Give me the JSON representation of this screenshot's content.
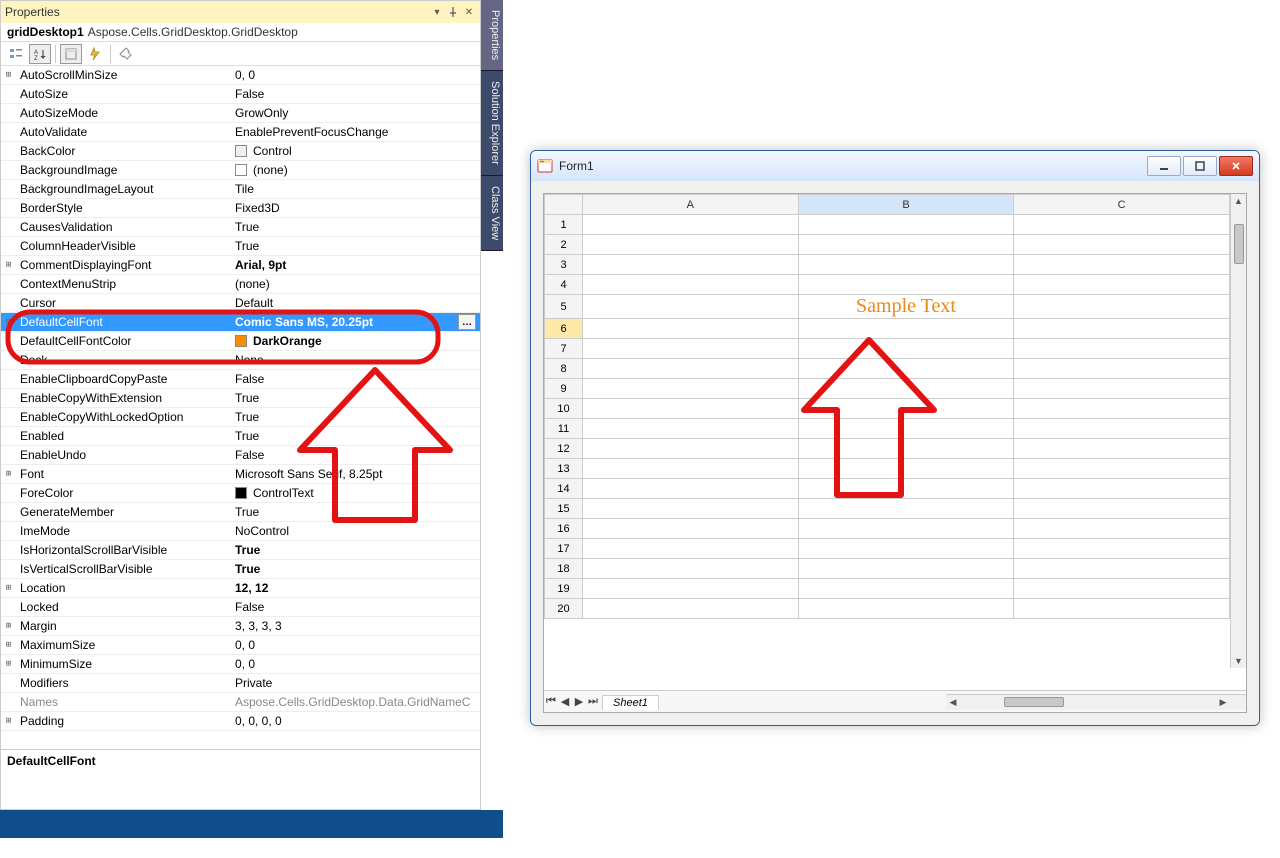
{
  "properties_panel": {
    "title": "Properties",
    "object_name": "gridDesktop1",
    "object_type": "Aspose.Cells.GridDesktop.GridDesktop",
    "help_property": "DefaultCellFont",
    "toolbar_icons": {
      "categorized": "categorized-icon",
      "alphabetical": "alphabetical-icon",
      "properties": "properties-icon",
      "events": "events-icon",
      "propertypages": "property-pages-icon"
    },
    "rows": [
      {
        "exp": "+",
        "name": "AutoScrollMinSize",
        "value": "0, 0"
      },
      {
        "name": "AutoSize",
        "value": "False"
      },
      {
        "name": "AutoSizeMode",
        "value": "GrowOnly"
      },
      {
        "name": "AutoValidate",
        "value": "EnablePreventFocusChange"
      },
      {
        "name": "BackColor",
        "value": "Control",
        "swatch": "#f0f0f0"
      },
      {
        "name": "BackgroundImage",
        "value": "(none)",
        "swatch": "#ffffff"
      },
      {
        "name": "BackgroundImageLayout",
        "value": "Tile"
      },
      {
        "name": "BorderStyle",
        "value": "Fixed3D"
      },
      {
        "name": "CausesValidation",
        "value": "True"
      },
      {
        "name": "ColumnHeaderVisible",
        "value": "True"
      },
      {
        "exp": "+",
        "name": "CommentDisplayingFont",
        "value": "Arial, 9pt",
        "bold": true
      },
      {
        "name": "ContextMenuStrip",
        "value": "(none)"
      },
      {
        "name": "Cursor",
        "value": "Default"
      },
      {
        "exp": "+",
        "name": "DefaultCellFont",
        "value": "Comic Sans MS, 20.25pt",
        "bold": true,
        "selected": true,
        "ellipsis": true
      },
      {
        "name": "DefaultCellFontColor",
        "value": "DarkOrange",
        "swatch": "#ff8c00",
        "bold": true
      },
      {
        "name": "Dock",
        "value": "None"
      },
      {
        "name": "EnableClipboardCopyPaste",
        "value": "False"
      },
      {
        "name": "EnableCopyWithExtension",
        "value": "True"
      },
      {
        "name": "EnableCopyWithLockedOption",
        "value": "True"
      },
      {
        "name": "Enabled",
        "value": "True"
      },
      {
        "name": "EnableUndo",
        "value": "False"
      },
      {
        "exp": "+",
        "name": "Font",
        "value": "Microsoft Sans Serif, 8.25pt"
      },
      {
        "name": "ForeColor",
        "value": "ControlText",
        "swatch": "#000000"
      },
      {
        "name": "GenerateMember",
        "value": "True"
      },
      {
        "name": "ImeMode",
        "value": "NoControl"
      },
      {
        "name": "IsHorizontalScrollBarVisible",
        "value": "True",
        "bold": true
      },
      {
        "name": "IsVerticalScrollBarVisible",
        "value": "True",
        "bold": true
      },
      {
        "exp": "+",
        "name": "Location",
        "value": "12, 12",
        "bold": true
      },
      {
        "name": "Locked",
        "value": "False"
      },
      {
        "exp": "+",
        "name": "Margin",
        "value": "3, 3, 3, 3"
      },
      {
        "exp": "+",
        "name": "MaximumSize",
        "value": "0, 0"
      },
      {
        "exp": "+",
        "name": "MinimumSize",
        "value": "0, 0"
      },
      {
        "name": "Modifiers",
        "value": "Private"
      },
      {
        "name": "Names",
        "value": "Aspose.Cells.GridDesktop.Data.GridNameC",
        "disabled": true
      },
      {
        "exp": "+",
        "name": "Padding",
        "value": "0, 0, 0, 0"
      }
    ]
  },
  "side_tabs": {
    "properties": "Properties",
    "solution": "Solution Explorer",
    "classview": "Class View"
  },
  "form1": {
    "title": "Form1",
    "columns": [
      "A",
      "B",
      "C"
    ],
    "rowcount": 20,
    "selected_row": 6,
    "selected_col_index": 1,
    "sample_text_row": 5,
    "sample_text_col": 1,
    "sample_text": "Sample Text",
    "sheet_tab": "Sheet1"
  }
}
